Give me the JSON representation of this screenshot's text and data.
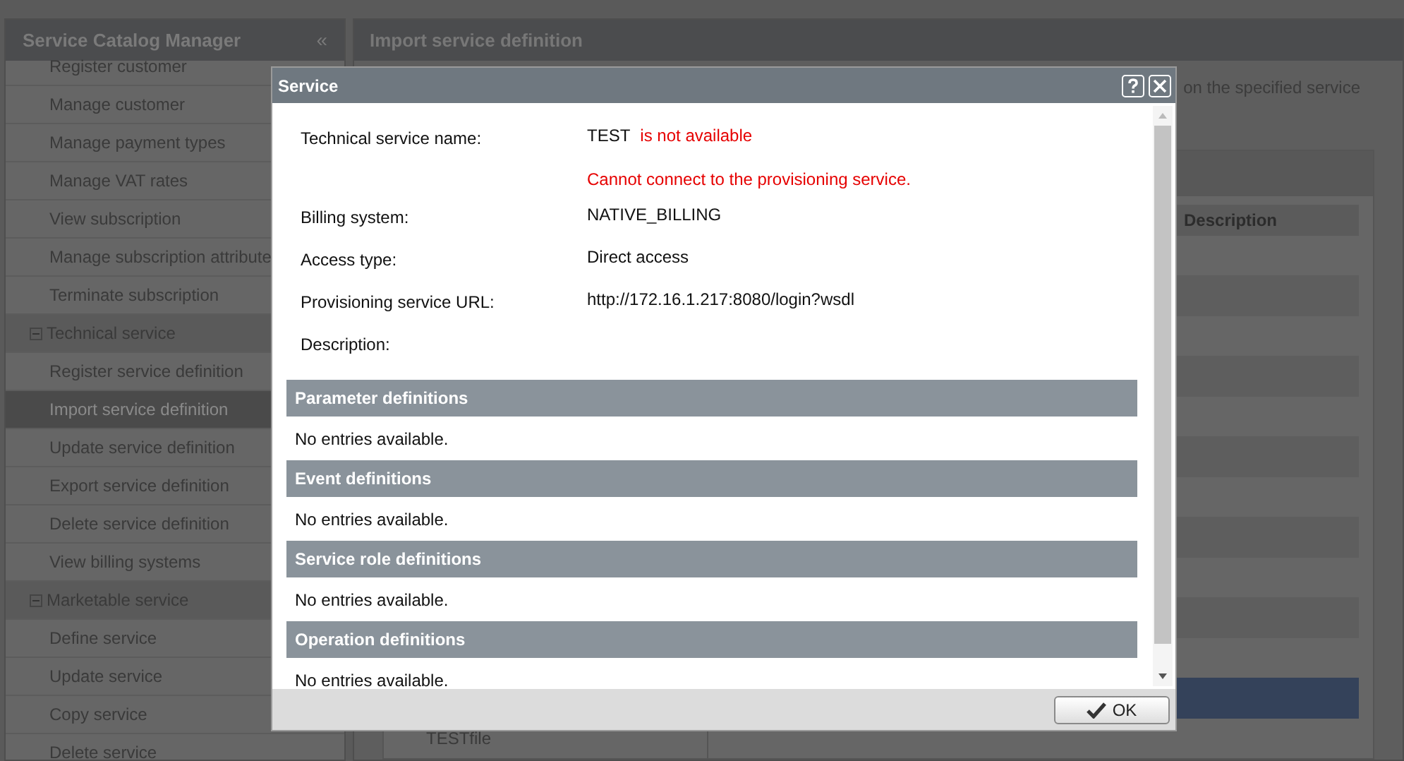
{
  "sidebar": {
    "title": "Service Catalog Manager",
    "collapse_glyph": "«",
    "items": [
      {
        "label": "Register customer",
        "kind": "link",
        "selected": false
      },
      {
        "label": "Manage customer",
        "kind": "link",
        "selected": false
      },
      {
        "label": "Manage payment types",
        "kind": "link",
        "selected": false
      },
      {
        "label": "Manage VAT rates",
        "kind": "link",
        "selected": false
      },
      {
        "label": "View subscription",
        "kind": "link",
        "selected": false
      },
      {
        "label": "Manage subscription attribute",
        "kind": "link",
        "selected": false
      },
      {
        "label": "Terminate subscription",
        "kind": "link",
        "selected": false
      },
      {
        "label": "Technical service",
        "kind": "group",
        "expanded": true,
        "children": [
          {
            "label": "Register service definition",
            "kind": "link",
            "selected": false
          },
          {
            "label": "Import service definition",
            "kind": "link",
            "selected": true
          },
          {
            "label": "Update service definition",
            "kind": "link",
            "selected": false
          },
          {
            "label": "Export service definition",
            "kind": "link",
            "selected": false
          },
          {
            "label": "Delete service definition",
            "kind": "link",
            "selected": false
          },
          {
            "label": "View billing systems",
            "kind": "link",
            "selected": false
          }
        ]
      },
      {
        "label": "Marketable service",
        "kind": "group",
        "expanded": true,
        "children": [
          {
            "label": "Define service",
            "kind": "link",
            "selected": false
          },
          {
            "label": "Update service",
            "kind": "link",
            "selected": false
          },
          {
            "label": "Copy service",
            "kind": "link",
            "selected": false
          },
          {
            "label": "Delete service",
            "kind": "link",
            "selected": false
          }
        ]
      }
    ]
  },
  "main": {
    "title": "Import service definition",
    "intro": "on the specified service",
    "table": {
      "columns": [
        "Description"
      ],
      "rows": [
        {
          "selected": false
        },
        {
          "selected": false
        },
        {
          "selected": false
        },
        {
          "selected": false
        },
        {
          "selected": false
        },
        {
          "selected": false
        },
        {
          "selected": false
        },
        {
          "selected": false
        },
        {
          "selected": false
        },
        {
          "selected": false
        },
        {
          "selected": false
        },
        {
          "selected": true
        },
        {
          "selected": false,
          "column_1": "TESTfile"
        }
      ]
    }
  },
  "dialog": {
    "title": "Service",
    "fields": [
      {
        "label": "Technical service name:",
        "value": "TEST",
        "status": "is not available",
        "error": "Cannot connect to the provisioning service."
      },
      {
        "label": "Billing system:",
        "value": "NATIVE_BILLING"
      },
      {
        "label": "Access type:",
        "value": "Direct access"
      },
      {
        "label": "Provisioning service URL:",
        "value": "http://172.16.1.217:8080/login?wsdl"
      },
      {
        "label": "Description:"
      }
    ],
    "sections": [
      {
        "title": "Parameter definitions",
        "empty_text": "No entries available."
      },
      {
        "title": "Event definitions",
        "empty_text": "No entries available."
      },
      {
        "title": "Service role definitions",
        "empty_text": "No entries available."
      },
      {
        "title": "Operation definitions",
        "empty_text": "No entries available."
      }
    ],
    "buttons": [
      {
        "label": "OK"
      }
    ]
  }
}
